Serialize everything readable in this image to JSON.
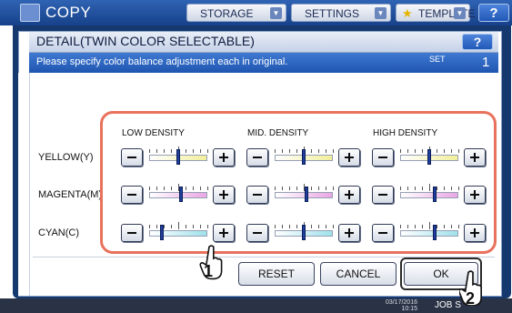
{
  "app": {
    "title": "COPY"
  },
  "top_tabs": {
    "storage": "STORAGE",
    "settings": "SETTINGS",
    "template": "TEMPLATE",
    "help": "?"
  },
  "dialog": {
    "title": "DETAIL(TWIN COLOR SELECTABLE)",
    "help": "?",
    "instruction": "Please specify color balance adjustment each in original.",
    "set_label": "SET",
    "set_value": "1"
  },
  "columns": [
    "LOW DENSITY",
    "MID. DENSITY",
    "HIGH DENSITY"
  ],
  "rows": [
    {
      "label": "YELLOW(Y)",
      "color": "yellow",
      "levels": [
        0.0,
        0.0,
        0.0
      ]
    },
    {
      "label": "MAGENTA(M)",
      "color": "magenta",
      "levels": [
        0.1,
        0.1,
        0.2
      ]
    },
    {
      "label": "CYAN(C)",
      "color": "cyan",
      "levels": [
        -0.6,
        0.0,
        0.2
      ]
    }
  ],
  "buttons": {
    "reset": "RESET",
    "cancel": "CANCEL",
    "ok": "OK"
  },
  "status": {
    "date": "03/17/2016",
    "time": "10:15",
    "job": "JOB S"
  },
  "callouts": {
    "step1": "1",
    "step2": "2"
  },
  "colors": {
    "highlight": "#e8725d",
    "titlebar": "#1f55b0",
    "knob": "#1f3e9e"
  }
}
